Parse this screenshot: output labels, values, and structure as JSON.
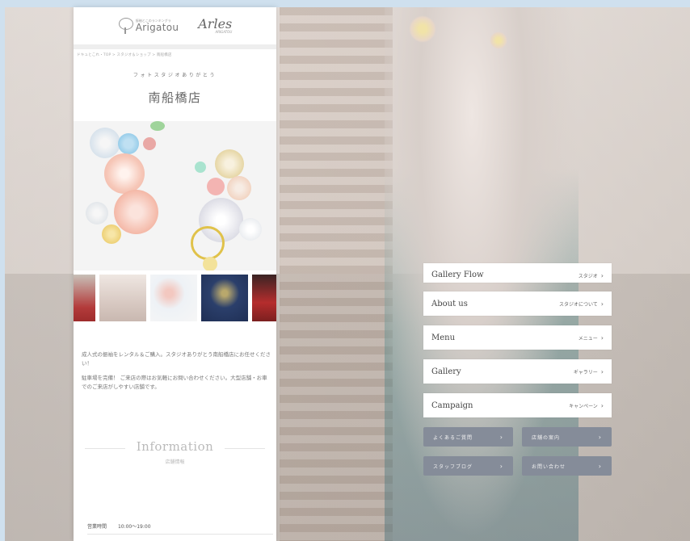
{
  "header": {
    "logo_small": "振袖とこのランキングラ",
    "logo_main": "Arigatou",
    "logo2_main": "Arles",
    "logo2_small": "ARIGATOU"
  },
  "breadcrumb": "ドキュとこれ・TOP > スタジオ＆ショップ > 南船橋店",
  "subtitle": "フォトスタジオありがとう",
  "store_name": "南船橋店",
  "intro": [
    "成人式の振袖をレンタル＆ご購入。スタジオありがとう南船橋店にお任せください！",
    "駐車場を完備！ ご来店の際はお気軽にお問い合わせください。大型店舗・お車でのご来店がしやすい店舗です。"
  ],
  "info": {
    "title": "Information",
    "subtitle": "店舗情報"
  },
  "hours": {
    "label": "営業時間",
    "value": "10:00〜19:00"
  },
  "menu_partial": {
    "label": "Gallery Flow",
    "jp": "スタジオ"
  },
  "menu": [
    {
      "label": "About us",
      "jp": "スタジオについて"
    },
    {
      "label": "Menu",
      "jp": "メニュー"
    },
    {
      "label": "Gallery",
      "jp": "ギャラリー"
    },
    {
      "label": "Campaign",
      "jp": "キャンペーン"
    }
  ],
  "sub_buttons": [
    {
      "label": "よくあるご質問"
    },
    {
      "label": "店舗の案内"
    },
    {
      "label": "スタッフブログ"
    },
    {
      "label": "お問い合わせ"
    }
  ],
  "icons": {
    "chevron": "chevron-right-icon",
    "logo": "tree-logo-icon"
  },
  "colors": {
    "sub_button": "#858c99",
    "panel_bg": "#ffffff",
    "page_bg": "#cfe0ee"
  }
}
